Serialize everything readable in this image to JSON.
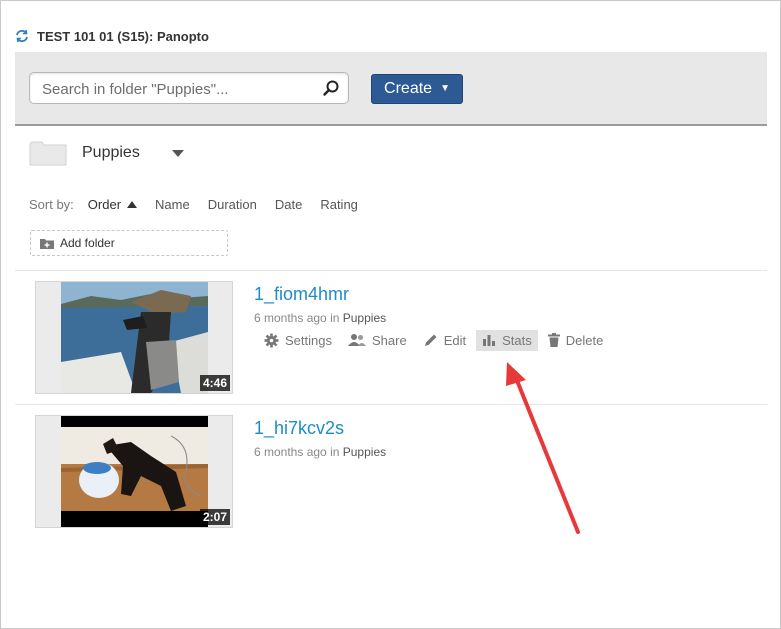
{
  "window": {
    "title": "TEST 101 01 (S15): Panopto"
  },
  "toolbar": {
    "search_placeholder": "Search in folder \"Puppies\"...",
    "create_label": "Create"
  },
  "folder": {
    "name": "Puppies"
  },
  "sort": {
    "label": "Sort by:",
    "options": [
      "Order",
      "Name",
      "Duration",
      "Date",
      "Rating"
    ],
    "active": "Order"
  },
  "add_folder_label": "Add folder",
  "sessions": [
    {
      "title": "1_fiom4hmr",
      "age": "6 months ago",
      "in_text": "in",
      "folder": "Puppies",
      "duration": "4:46",
      "actions": [
        "Settings",
        "Share",
        "Edit",
        "Stats",
        "Delete"
      ]
    },
    {
      "title": "1_hi7kcv2s",
      "age": "6 months ago",
      "in_text": "in",
      "folder": "Puppies",
      "duration": "2:07"
    }
  ],
  "annotation": {
    "arrow_color": "#e8393a",
    "points_to": "Stats"
  }
}
